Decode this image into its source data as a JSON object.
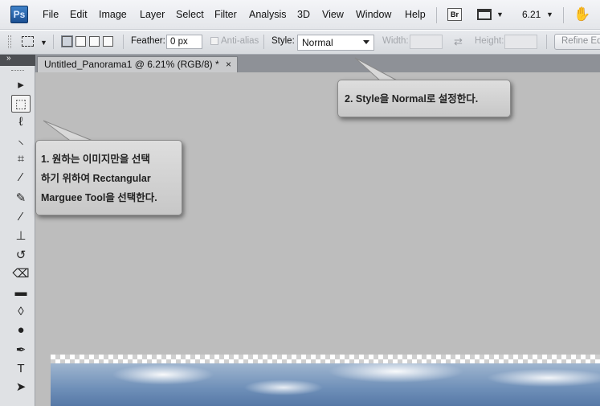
{
  "app": {
    "logo_text": "Ps"
  },
  "menu": {
    "items": [
      "File",
      "Edit",
      "Image",
      "Layer",
      "Select",
      "Filter",
      "Analysis",
      "3D",
      "View",
      "Window",
      "Help"
    ],
    "bridge_label": "Br",
    "zoom": "6.21"
  },
  "options": {
    "feather_label": "Feather:",
    "feather_value": "0 px",
    "antialias_label": "Anti-alias",
    "style_label": "Style:",
    "style_value": "Normal",
    "width_label": "Width:",
    "height_label": "Height:",
    "refine_label": "Refine Ed"
  },
  "document": {
    "tab_title": "Untitled_Panorama1 @ 6.21% (RGB/8) *",
    "close_glyph": "×"
  },
  "tools": {
    "items": [
      {
        "name": "move-tool-icon",
        "glyph": "▸"
      },
      {
        "name": "rectangular-marquee-tool-icon",
        "glyph": "⬚",
        "selected": true
      },
      {
        "name": "lasso-tool-icon",
        "glyph": "ℓ"
      },
      {
        "name": "quick-selection-tool-icon",
        "glyph": "⸜"
      },
      {
        "name": "crop-tool-icon",
        "glyph": "⌗"
      },
      {
        "name": "eyedropper-tool-icon",
        "glyph": "⁄"
      },
      {
        "name": "healing-brush-tool-icon",
        "glyph": "✎"
      },
      {
        "name": "brush-tool-icon",
        "glyph": "⁄"
      },
      {
        "name": "clone-stamp-tool-icon",
        "glyph": "⊥"
      },
      {
        "name": "history-brush-tool-icon",
        "glyph": "↺"
      },
      {
        "name": "eraser-tool-icon",
        "glyph": "⌫"
      },
      {
        "name": "gradient-tool-icon",
        "glyph": "▬"
      },
      {
        "name": "blur-tool-icon",
        "glyph": "◊"
      },
      {
        "name": "dodge-tool-icon",
        "glyph": "●"
      },
      {
        "name": "pen-tool-icon",
        "glyph": "✒"
      },
      {
        "name": "type-tool-icon",
        "glyph": "T"
      },
      {
        "name": "path-selection-tool-icon",
        "glyph": "➤"
      }
    ]
  },
  "callouts": {
    "style_note": "2. Style을 Normal로 설정한다.",
    "marquee_line1": "1. 원하는 이미지만을 선택",
    "marquee_line2": "하기 위하여 Rectangular",
    "marquee_line3": "Marguee Tool을 선택한다."
  }
}
